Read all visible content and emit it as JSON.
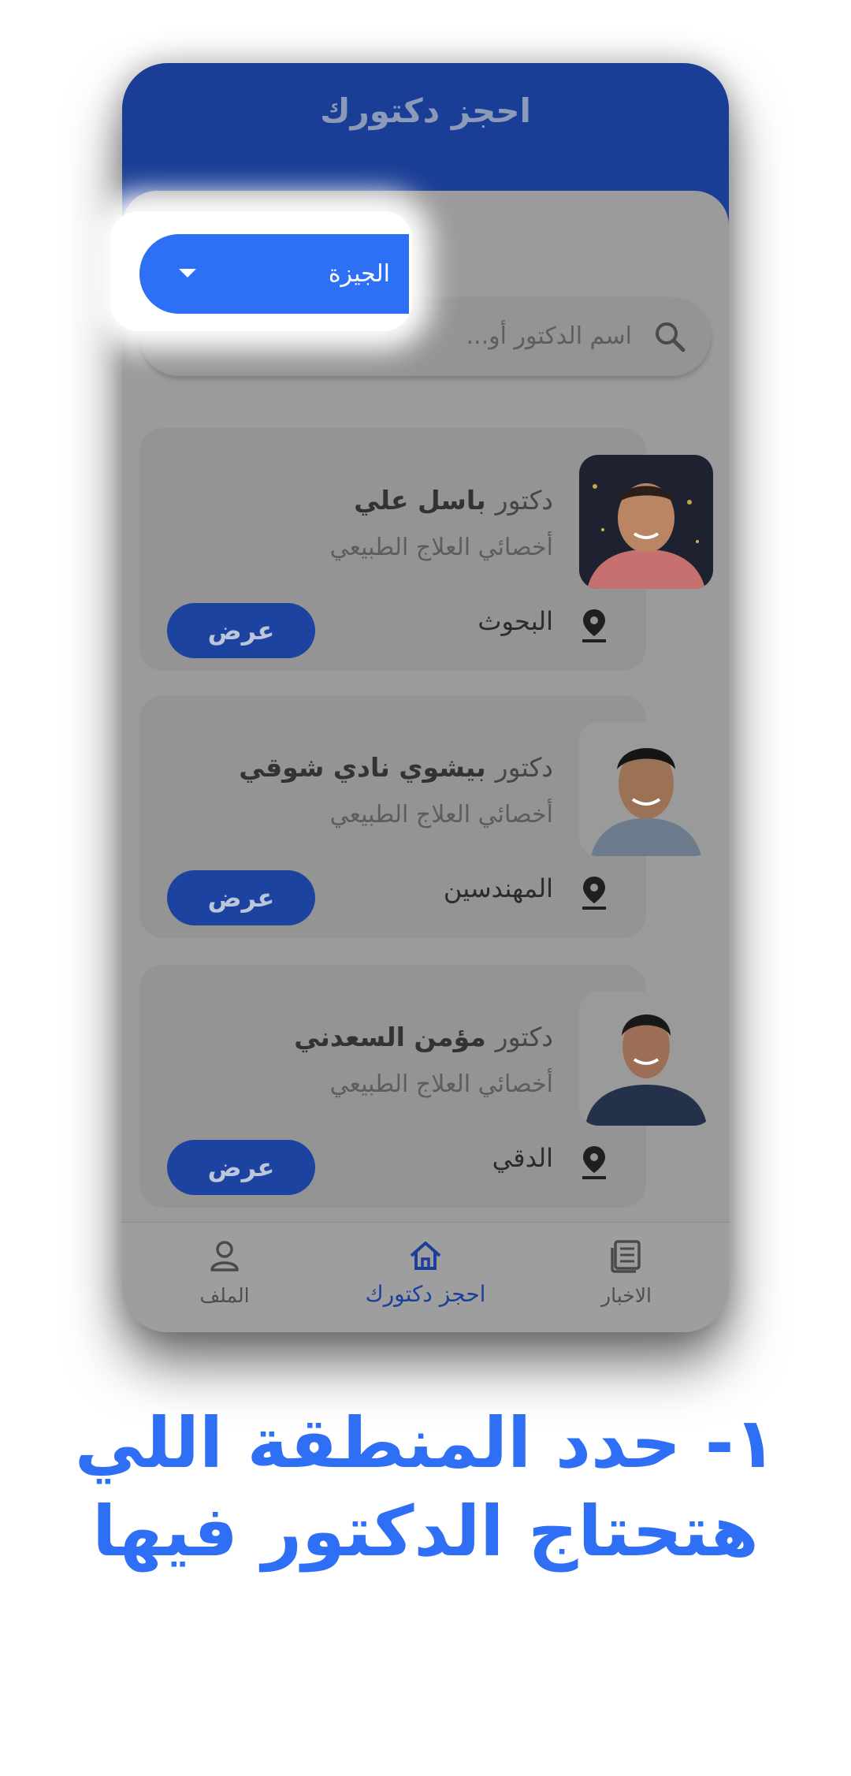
{
  "app": {
    "title": "احجز دكتورك"
  },
  "search": {
    "placeholder": "اسم الدكتور أو...",
    "icon": "search-icon"
  },
  "region": {
    "selected": "الجيزة",
    "icon": "caret-down-icon"
  },
  "doctors": [
    {
      "prefix": "دكتور",
      "name": "باسل علي",
      "specialty": "أخصائي العلاج الطبيعي",
      "location": "البحوث",
      "button": "عرض"
    },
    {
      "prefix": "دكتور",
      "name": "بيشوي نادي شوقي",
      "specialty": "أخصائي العلاج الطبيعي",
      "location": "المهندسين",
      "button": "عرض"
    },
    {
      "prefix": "دكتور",
      "name": "مؤمن السعدني",
      "specialty": "أخصائي العلاج الطبيعي",
      "location": "الدقي",
      "button": "عرض"
    }
  ],
  "nav": {
    "news": "الاخبار",
    "book": "احجز دكتورك",
    "profile": "الملف"
  },
  "caption": {
    "line1": "١- حدد المنطقة اللي",
    "line2": "هتحتاج الدكتور فيها"
  },
  "colors": {
    "header": "#1a3e96",
    "accent": "#2d6ff5",
    "caption": "#2f6ff5",
    "overlay": "#9b9b9b"
  }
}
